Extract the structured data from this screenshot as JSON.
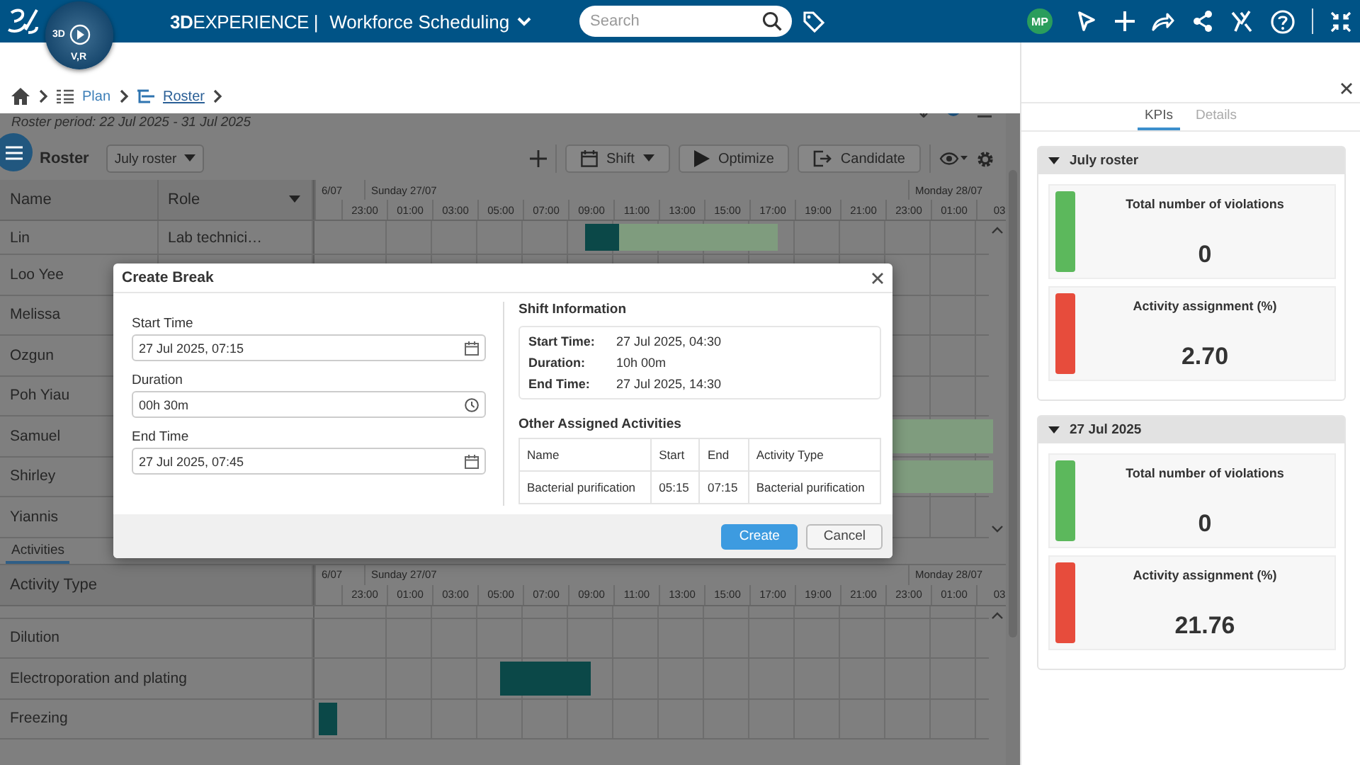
{
  "top_bar": {
    "compass": {
      "top_label": "3D",
      "bottom_label": "V,R"
    },
    "brand": "**3D**EXPERIENCE |",
    "app_title": "Workforce Scheduling",
    "search": {
      "placeholder": "Search"
    },
    "avatar": "MP"
  },
  "breadcrumb": [
    {
      "label": "Plan",
      "selected": false
    },
    {
      "label": "Roster",
      "selected": true
    }
  ],
  "roster": {
    "period": "Roster period: 22 Jul 2025 - 31 Jul 2025",
    "title": "Roster",
    "dropdown": "July roster",
    "toolbar": [
      {
        "label": "Shift",
        "kind": "menu"
      },
      {
        "label": "Optimize",
        "kind": "run"
      },
      {
        "label": "Candidate",
        "kind": "assign"
      }
    ],
    "gantt": {
      "columns": [
        "Name",
        "Role"
      ],
      "days": [
        "6/07",
        "Sunday 27/07",
        "Monday 28/07"
      ],
      "hours": [
        "23:00",
        "01:00",
        "03:00",
        "05:00",
        "07:00",
        "09:00",
        "11:00",
        "13:00",
        "15:00",
        "17:00",
        "19:00",
        "21:00",
        "23:00",
        "01:00",
        "03"
      ],
      "rows": [
        {
          "name": "Lin",
          "role": "Lab technici…",
          "bars": [
            {
              "kind": "activity"
            },
            {
              "kind": "shift"
            }
          ]
        },
        {
          "name": "Loo Yee"
        },
        {
          "name": "Melissa"
        },
        {
          "name": "Ozgun"
        },
        {
          "name": "Poh Yiau"
        },
        {
          "name": "Samuel",
          "bars": [
            {
              "kind": "shift"
            }
          ]
        },
        {
          "name": "Shirley",
          "bars": [
            {
              "kind": "shift"
            }
          ]
        },
        {
          "name": "Yiannis"
        }
      ]
    },
    "activities": {
      "tab": {
        "label": "Activities",
        "selected": true
      },
      "columns": [
        "Activity Type"
      ],
      "days": [
        "6/07",
        "Sunday 27/07",
        "Monday 28/07"
      ],
      "hours": [
        "23:00",
        "01:00",
        "03:00",
        "05:00",
        "07:00",
        "09:00",
        "11:00",
        "13:00",
        "15:00",
        "17:00",
        "19:00",
        "21:00",
        "23:00",
        "01:00",
        "03"
      ],
      "rows": [
        {
          "name": "Dilution"
        },
        {
          "name": "Electroporation and plating",
          "bars": [
            {
              "kind": "activity"
            }
          ]
        },
        {
          "name": "Freezing",
          "bars": [
            {
              "kind": "activity"
            }
          ]
        }
      ]
    }
  },
  "dialog": {
    "title": "Create Break",
    "fields": [
      {
        "label": "Start Time",
        "value": "27 Jul 2025, 07:15",
        "kind": "date"
      },
      {
        "label": "Duration",
        "value": "00h 30m",
        "kind": "time"
      },
      {
        "label": "End Time",
        "value": "27 Jul 2025, 07:45",
        "kind": "date"
      }
    ],
    "shift_info": {
      "title": "Shift Information",
      "items": [
        {
          "label": "Start Time:",
          "value": "27 Jul 2025, 04:30"
        },
        {
          "label": "Duration:",
          "value": "10h 00m"
        },
        {
          "label": "End Time:",
          "value": "27 Jul 2025, 14:30"
        }
      ]
    },
    "activities": {
      "title": "Other Assigned Activities",
      "columns": [
        "Name",
        "Start",
        "End",
        "Activity Type"
      ],
      "rows": [
        [
          "Bacterial purification",
          "05:15",
          "07:15",
          "Bacterial purification"
        ]
      ]
    },
    "buttons": [
      {
        "label": "Create",
        "kind": "primary"
      },
      {
        "label": "Cancel",
        "kind": "secondary"
      }
    ]
  },
  "kpi_panel": {
    "tabs": [
      {
        "label": "KPIs",
        "selected": true
      },
      {
        "label": "Details",
        "selected": false
      }
    ],
    "sections": [
      {
        "title": "July roster",
        "expanded": true,
        "kpis": [
          {
            "label": "Total number of violations",
            "value": "0",
            "color": "#5cb85c"
          },
          {
            "label": "Activity assignment (%)",
            "value": "2.70",
            "color": "#e74c3c"
          }
        ]
      },
      {
        "title": "27 Jul 2025",
        "expanded": true,
        "kpis": [
          {
            "label": "Total number of violations",
            "value": "0",
            "color": "#5cb85c"
          },
          {
            "label": "Activity assignment (%)",
            "value": "21.76",
            "color": "#e74c3c"
          }
        ]
      }
    ]
  }
}
